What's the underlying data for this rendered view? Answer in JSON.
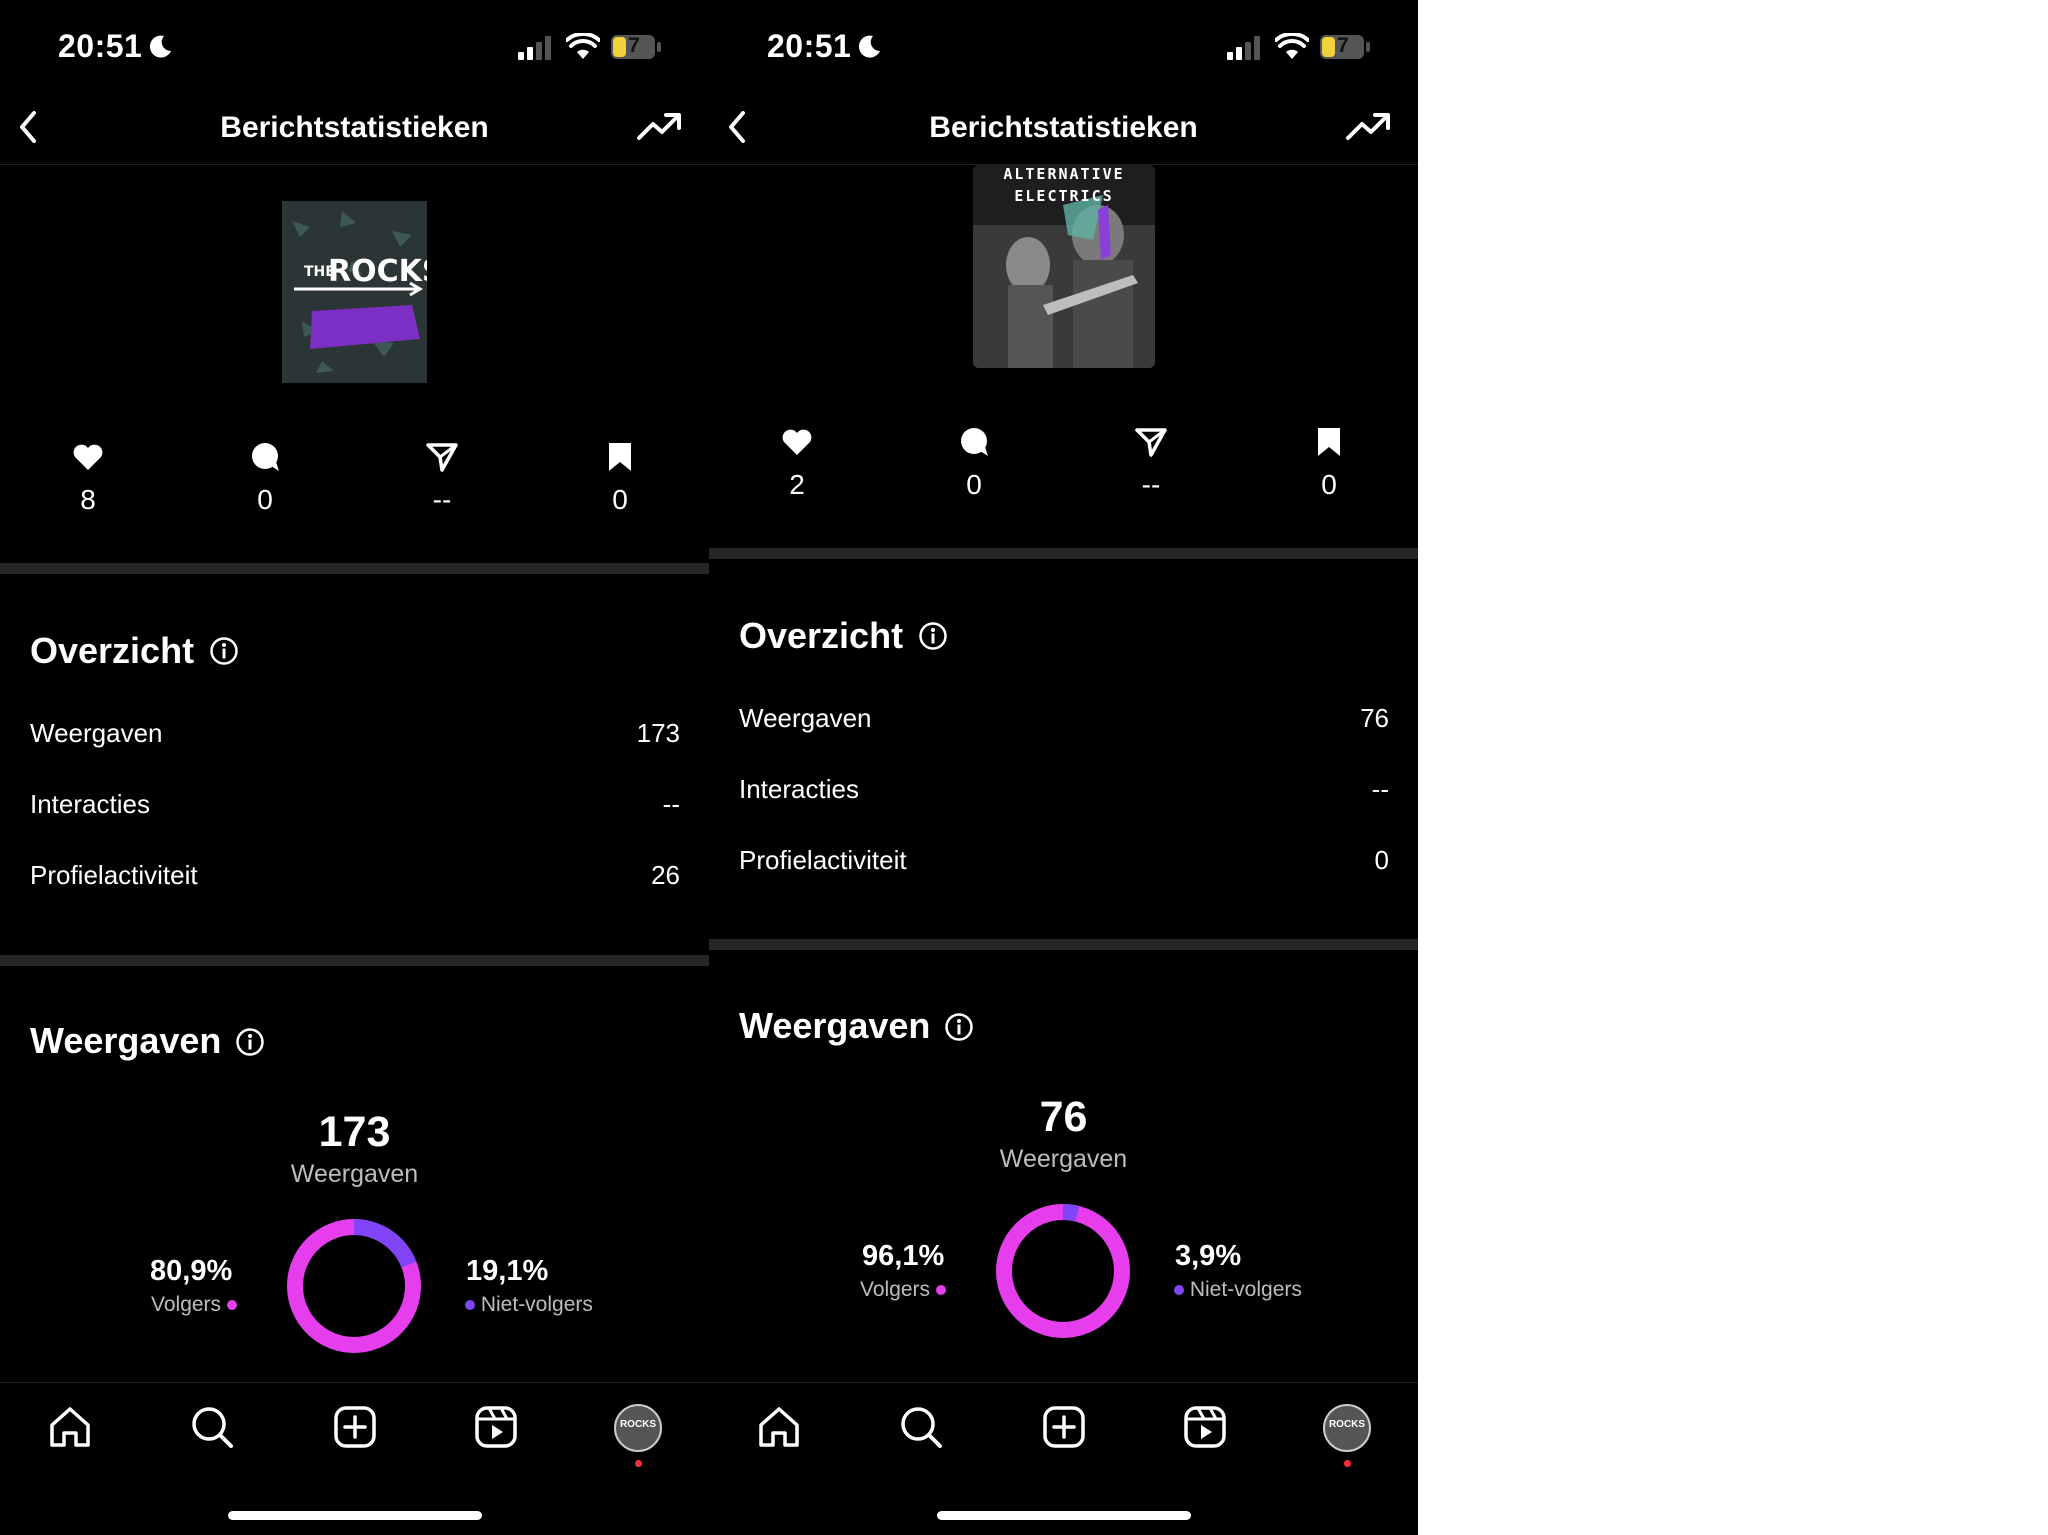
{
  "colors": {
    "background": "#000000",
    "followers": "#e63ded",
    "non_followers": "#7f45f6",
    "divider": "#262626"
  },
  "screens": [
    {
      "status": {
        "time": "20:51",
        "battery": "7"
      },
      "header": {
        "title": "Berichtstatistieken"
      },
      "post": {
        "thumbnail_text_top": "THE",
        "thumbnail_text_main": "ROCKS"
      },
      "stats": {
        "likes": "8",
        "comments": "0",
        "shares": "--",
        "saves": "0"
      },
      "overview": {
        "title": "Overzicht",
        "rows": [
          {
            "label": "Weergaven",
            "value": "173"
          },
          {
            "label": "Interacties",
            "value": "--"
          },
          {
            "label": "Profielactiviteit",
            "value": "26"
          }
        ]
      },
      "views": {
        "title": "Weergaven",
        "total": "173",
        "total_label": "Weergaven",
        "followers_pct": "80,9%",
        "followers_label": "Volgers",
        "non_followers_pct": "19,1%",
        "non_followers_label": "Niet-volgers",
        "followers_fraction": 0.809
      },
      "tabs": [
        "home-icon",
        "search-icon",
        "create-icon",
        "reels-icon",
        "profile-avatar"
      ],
      "profile_avatar_text": "ROCKS"
    },
    {
      "status": {
        "time": "20:51",
        "battery": "7"
      },
      "header": {
        "title": "Berichtstatistieken"
      },
      "post": {
        "thumbnail_text_top": "ALTERNATIVE",
        "thumbnail_text_main": "ELECTRICS"
      },
      "stats": {
        "likes": "2",
        "comments": "0",
        "shares": "--",
        "saves": "0"
      },
      "overview": {
        "title": "Overzicht",
        "rows": [
          {
            "label": "Weergaven",
            "value": "76"
          },
          {
            "label": "Interacties",
            "value": "--"
          },
          {
            "label": "Profielactiviteit",
            "value": "0"
          }
        ]
      },
      "views": {
        "title": "Weergaven",
        "total": "76",
        "total_label": "Weergaven",
        "followers_pct": "96,1%",
        "followers_label": "Volgers",
        "non_followers_pct": "3,9%",
        "non_followers_label": "Niet-volgers",
        "followers_fraction": 0.961
      },
      "tabs": [
        "home-icon",
        "search-icon",
        "create-icon",
        "reels-icon",
        "profile-avatar"
      ],
      "profile_avatar_text": "ROCKS"
    }
  ]
}
